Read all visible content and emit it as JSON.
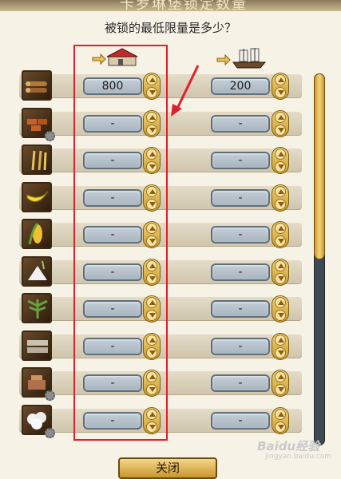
{
  "dialog": {
    "header_title": "卡罗琳堡锁定数量",
    "question": "被锁的最低限量是多少？"
  },
  "columns": {
    "left_icon": "warehouse-icon",
    "right_icon": "ship-icon"
  },
  "resources": [
    {
      "icon": "wood-icon",
      "left_value": "800",
      "right_value": "200"
    },
    {
      "icon": "bricks-icon",
      "left_value": "-",
      "right_value": "-"
    },
    {
      "icon": "wheat-icon",
      "left_value": "-",
      "right_value": "-"
    },
    {
      "icon": "banana-icon",
      "left_value": "-",
      "right_value": "-"
    },
    {
      "icon": "corn-icon",
      "left_value": "-",
      "right_value": "-"
    },
    {
      "icon": "flour-icon",
      "left_value": "-",
      "right_value": "-"
    },
    {
      "icon": "hemp-icon",
      "left_value": "-",
      "right_value": "-"
    },
    {
      "icon": "cloth-icon",
      "left_value": "-",
      "right_value": "-"
    },
    {
      "icon": "tools-icon",
      "left_value": "-",
      "right_value": "-"
    },
    {
      "icon": "cotton-icon",
      "left_value": "-",
      "right_value": "-"
    }
  ],
  "footer": {
    "close_label": "关闭"
  },
  "watermark": {
    "text": "Baidu经验",
    "sub": "jingyan.baidu.com"
  },
  "colors": {
    "highlight": "#e0202a",
    "gold": "#e6c25a"
  }
}
